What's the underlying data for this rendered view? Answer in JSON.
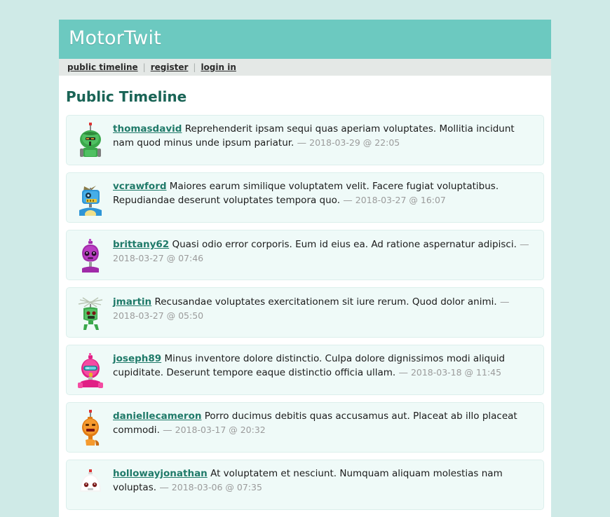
{
  "site": {
    "title": "MotorTwit",
    "accent_header": "#6cc9c0",
    "accent_link": "#1f7a69",
    "page_background": "#cfeae7",
    "entry_background": "#effaf8"
  },
  "nav": {
    "separator": "|",
    "items": [
      {
        "label": "public timeline",
        "name": "nav-public-timeline"
      },
      {
        "label": "register",
        "name": "nav-register"
      },
      {
        "label": "login in",
        "name": "nav-login-in"
      }
    ]
  },
  "main": {
    "heading": "Public Timeline"
  },
  "entries": [
    {
      "username": "thomasdavid",
      "message": "Reprehenderit ipsam sequi quas aperiam voluptates. Mollitia incidunt nam quod minus unde ipsum pariatur.",
      "separator": "—",
      "timestamp": "2018-03-29 @ 22:05",
      "avatar": "robot-avatar-green-helmet"
    },
    {
      "username": "vcrawford",
      "message": "Maiores earum similique voluptatem velit. Facere fugiat voluptatibus. Repudiandae deserunt voluptates tempora quo.",
      "separator": "—",
      "timestamp": "2018-03-27 @ 16:07",
      "avatar": "robot-avatar-blue-box"
    },
    {
      "username": "brittany62",
      "message": "Quasi odio error corporis. Eum id eius ea. Ad ratione aspernatur adipisci.",
      "separator": "—",
      "timestamp": "2018-03-27 @ 07:46",
      "avatar": "robot-avatar-purple-bulb"
    },
    {
      "username": "jmartin",
      "message": "Recusandae voluptates exercitationem sit iure rerum. Quod dolor animi.",
      "separator": "—",
      "timestamp": "2018-03-27 @ 05:50",
      "avatar": "robot-avatar-green-antenna"
    },
    {
      "username": "joseph89",
      "message": "Minus inventore dolore distinctio. Culpa dolore dignissimos modi aliquid cupiditate. Deserunt tempore eaque distinctio officia ullam.",
      "separator": "—",
      "timestamp": "2018-03-18 @ 11:45",
      "avatar": "robot-avatar-pink-visor"
    },
    {
      "username": "daniellecameron",
      "message": "Porro ducimus debitis quas accusamus aut. Placeat ab illo placeat commodi.",
      "separator": "—",
      "timestamp": "2018-03-17 @ 20:32",
      "avatar": "robot-avatar-orange-oval"
    },
    {
      "username": "hollowayjonathan",
      "message": "At voluptatem et nesciunt. Numquam aliquam molestias nam voluptas.",
      "separator": "—",
      "timestamp": "2018-03-06 @ 07:35",
      "avatar": "robot-avatar-white-dome"
    }
  ]
}
